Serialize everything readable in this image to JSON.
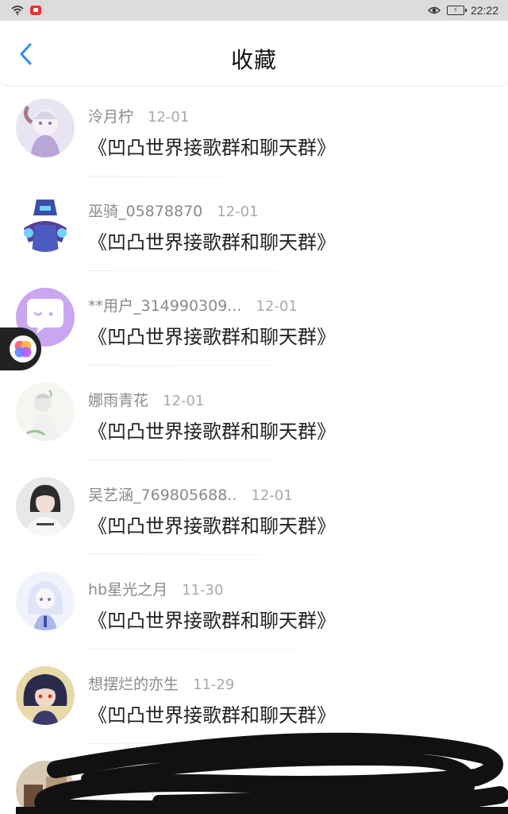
{
  "status_bar": {
    "time": "22:22",
    "icons": [
      "wifi-icon",
      "app-notification-icon",
      "eye-icon",
      "battery-icon"
    ]
  },
  "header": {
    "title": "收藏",
    "back_icon": "chevron-left-icon",
    "accent_color": "#2a8ff0"
  },
  "items": [
    {
      "name": "泠月柠",
      "date": "12-01",
      "content": "《凹凸世界接歌群和聊天群》",
      "avatar_colors": [
        "#e9e4f2",
        "#b9a6d8"
      ]
    },
    {
      "name": "巫骑_05878870",
      "date": "12-01",
      "content": "《凹凸世界接歌群和聊天群》",
      "avatar_colors": [
        "#ffffff",
        "#4a5bbd"
      ]
    },
    {
      "name": "**用户_314990309...",
      "date": "12-01",
      "content": "《凹凸世界接歌群和聊天群》",
      "avatar_colors": [
        "#c9a6f0",
        "#ffffff"
      ]
    },
    {
      "name": "娜雨青花",
      "date": "12-01",
      "content": "《凹凸世界接歌群和聊天群》",
      "avatar_colors": [
        "#f4f6f2",
        "#cfcfcf"
      ]
    },
    {
      "name": "吴艺涵_769805688..",
      "date": "12-01",
      "content": "《凹凸世界接歌群和聊天群》",
      "avatar_colors": [
        "#e8e8e8",
        "#2b2b2b"
      ]
    },
    {
      "name": "hb星光之月",
      "date": "11-30",
      "content": "《凹凸世界接歌群和聊天群》",
      "avatar_colors": [
        "#f1f3fb",
        "#aab7e8"
      ]
    },
    {
      "name": "想摆烂的亦生",
      "date": "11-29",
      "content": "《凹凸世界接歌群和聊天群》",
      "avatar_colors": [
        "#e8d9a8",
        "#2a2a4a"
      ]
    }
  ]
}
